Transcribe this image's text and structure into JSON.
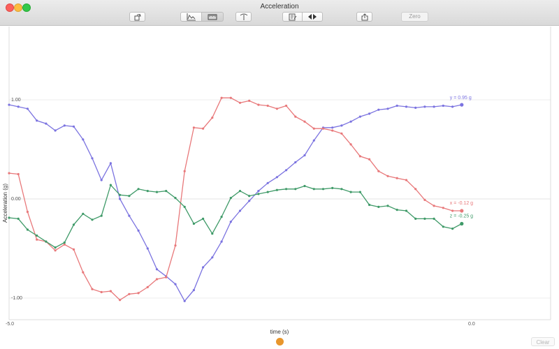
{
  "window": {
    "title": "Acceleration"
  },
  "toolbar": {
    "zero_label": "Zero"
  },
  "footer": {
    "clear_label": "Clear"
  },
  "colors": {
    "x": "#e8787a",
    "y": "#7b73e0",
    "z": "#3f9a68",
    "scrubber": "#e8962c"
  },
  "chart_data": {
    "type": "line",
    "xlabel": "time (s)",
    "ylabel": "Acceleration (g)",
    "xlim": [
      -5.0,
      0.0
    ],
    "ylim": [
      -1.0,
      1.0
    ],
    "x_ticks": [
      "-5.0",
      "0.0"
    ],
    "y_ticks": [
      "1.00",
      "0.00",
      "-1.00"
    ],
    "series": [
      {
        "name": "y",
        "label": "y = 0.95 g",
        "color": "#7b73e0",
        "points": [
          [
            -5.0,
            0.95
          ],
          [
            -4.9,
            0.93
          ],
          [
            -4.8,
            0.91
          ],
          [
            -4.7,
            0.79
          ],
          [
            -4.6,
            0.76
          ],
          [
            -4.5,
            0.69
          ],
          [
            -4.4,
            0.74
          ],
          [
            -4.3,
            0.73
          ],
          [
            -4.2,
            0.6
          ],
          [
            -4.1,
            0.41
          ],
          [
            -4.0,
            0.19
          ],
          [
            -3.9,
            0.36
          ],
          [
            -3.8,
            0.0
          ],
          [
            -3.7,
            -0.17
          ],
          [
            -3.6,
            -0.32
          ],
          [
            -3.5,
            -0.5
          ],
          [
            -3.4,
            -0.71
          ],
          [
            -3.3,
            -0.78
          ],
          [
            -3.2,
            -0.86
          ],
          [
            -3.1,
            -1.03
          ],
          [
            -3.0,
            -0.92
          ],
          [
            -2.9,
            -0.69
          ],
          [
            -2.8,
            -0.59
          ],
          [
            -2.7,
            -0.43
          ],
          [
            -2.6,
            -0.23
          ],
          [
            -2.5,
            -0.12
          ],
          [
            -2.4,
            -0.02
          ],
          [
            -2.3,
            0.08
          ],
          [
            -2.2,
            0.16
          ],
          [
            -2.1,
            0.22
          ],
          [
            -2.0,
            0.29
          ],
          [
            -1.9,
            0.37
          ],
          [
            -1.8,
            0.44
          ],
          [
            -1.7,
            0.59
          ],
          [
            -1.6,
            0.72
          ],
          [
            -1.5,
            0.72
          ],
          [
            -1.4,
            0.74
          ],
          [
            -1.3,
            0.78
          ],
          [
            -1.2,
            0.83
          ],
          [
            -1.1,
            0.86
          ],
          [
            -1.0,
            0.9
          ],
          [
            -0.9,
            0.91
          ],
          [
            -0.8,
            0.94
          ],
          [
            -0.7,
            0.93
          ],
          [
            -0.6,
            0.92
          ],
          [
            -0.5,
            0.93
          ],
          [
            -0.4,
            0.93
          ],
          [
            -0.3,
            0.94
          ],
          [
            -0.2,
            0.93
          ],
          [
            -0.1,
            0.95
          ]
        ]
      },
      {
        "name": "x",
        "label": "x = -0.12 g",
        "color": "#e8787a",
        "points": [
          [
            -5.0,
            0.26
          ],
          [
            -4.9,
            0.25
          ],
          [
            -4.8,
            -0.13
          ],
          [
            -4.7,
            -0.41
          ],
          [
            -4.6,
            -0.43
          ],
          [
            -4.5,
            -0.52
          ],
          [
            -4.4,
            -0.46
          ],
          [
            -4.3,
            -0.51
          ],
          [
            -4.2,
            -0.74
          ],
          [
            -4.1,
            -0.91
          ],
          [
            -4.0,
            -0.94
          ],
          [
            -3.9,
            -0.93
          ],
          [
            -3.8,
            -1.02
          ],
          [
            -3.7,
            -0.96
          ],
          [
            -3.6,
            -0.95
          ],
          [
            -3.5,
            -0.89
          ],
          [
            -3.4,
            -0.81
          ],
          [
            -3.3,
            -0.79
          ],
          [
            -3.2,
            -0.47
          ],
          [
            -3.1,
            0.28
          ],
          [
            -3.0,
            0.72
          ],
          [
            -2.9,
            0.71
          ],
          [
            -2.8,
            0.82
          ],
          [
            -2.7,
            1.02
          ],
          [
            -2.6,
            1.02
          ],
          [
            -2.5,
            0.97
          ],
          [
            -2.4,
            0.99
          ],
          [
            -2.3,
            0.95
          ],
          [
            -2.2,
            0.94
          ],
          [
            -2.1,
            0.91
          ],
          [
            -2.0,
            0.94
          ],
          [
            -1.9,
            0.83
          ],
          [
            -1.8,
            0.78
          ],
          [
            -1.7,
            0.71
          ],
          [
            -1.6,
            0.71
          ],
          [
            -1.5,
            0.69
          ],
          [
            -1.4,
            0.66
          ],
          [
            -1.3,
            0.55
          ],
          [
            -1.2,
            0.43
          ],
          [
            -1.1,
            0.4
          ],
          [
            -1.0,
            0.28
          ],
          [
            -0.9,
            0.23
          ],
          [
            -0.8,
            0.21
          ],
          [
            -0.7,
            0.19
          ],
          [
            -0.6,
            0.1
          ],
          [
            -0.5,
            -0.01
          ],
          [
            -0.4,
            -0.07
          ],
          [
            -0.3,
            -0.09
          ],
          [
            -0.2,
            -0.12
          ],
          [
            -0.1,
            -0.12
          ]
        ]
      },
      {
        "name": "z",
        "label": "z = -0.25 g",
        "color": "#3f9a68",
        "points": [
          [
            -5.0,
            -0.19
          ],
          [
            -4.9,
            -0.2
          ],
          [
            -4.8,
            -0.31
          ],
          [
            -4.7,
            -0.37
          ],
          [
            -4.6,
            -0.43
          ],
          [
            -4.5,
            -0.49
          ],
          [
            -4.4,
            -0.44
          ],
          [
            -4.3,
            -0.26
          ],
          [
            -4.2,
            -0.15
          ],
          [
            -4.1,
            -0.21
          ],
          [
            -4.0,
            -0.17
          ],
          [
            -3.9,
            0.14
          ],
          [
            -3.8,
            0.04
          ],
          [
            -3.7,
            0.03
          ],
          [
            -3.6,
            0.1
          ],
          [
            -3.5,
            0.08
          ],
          [
            -3.4,
            0.07
          ],
          [
            -3.3,
            0.08
          ],
          [
            -3.2,
            0.01
          ],
          [
            -3.1,
            -0.08
          ],
          [
            -3.0,
            -0.25
          ],
          [
            -2.9,
            -0.2
          ],
          [
            -2.8,
            -0.35
          ],
          [
            -2.7,
            -0.18
          ],
          [
            -2.6,
            0.01
          ],
          [
            -2.5,
            0.08
          ],
          [
            -2.4,
            0.03
          ],
          [
            -2.3,
            0.05
          ],
          [
            -2.2,
            0.07
          ],
          [
            -2.1,
            0.09
          ],
          [
            -2.0,
            0.1
          ],
          [
            -1.9,
            0.1
          ],
          [
            -1.8,
            0.13
          ],
          [
            -1.7,
            0.1
          ],
          [
            -1.6,
            0.1
          ],
          [
            -1.5,
            0.11
          ],
          [
            -1.4,
            0.1
          ],
          [
            -1.3,
            0.07
          ],
          [
            -1.2,
            0.07
          ],
          [
            -1.1,
            -0.06
          ],
          [
            -1.0,
            -0.08
          ],
          [
            -0.9,
            -0.07
          ],
          [
            -0.8,
            -0.11
          ],
          [
            -0.7,
            -0.12
          ],
          [
            -0.6,
            -0.2
          ],
          [
            -0.5,
            -0.2
          ],
          [
            -0.4,
            -0.2
          ],
          [
            -0.3,
            -0.28
          ],
          [
            -0.2,
            -0.3
          ],
          [
            -0.1,
            -0.25
          ]
        ]
      }
    ]
  }
}
